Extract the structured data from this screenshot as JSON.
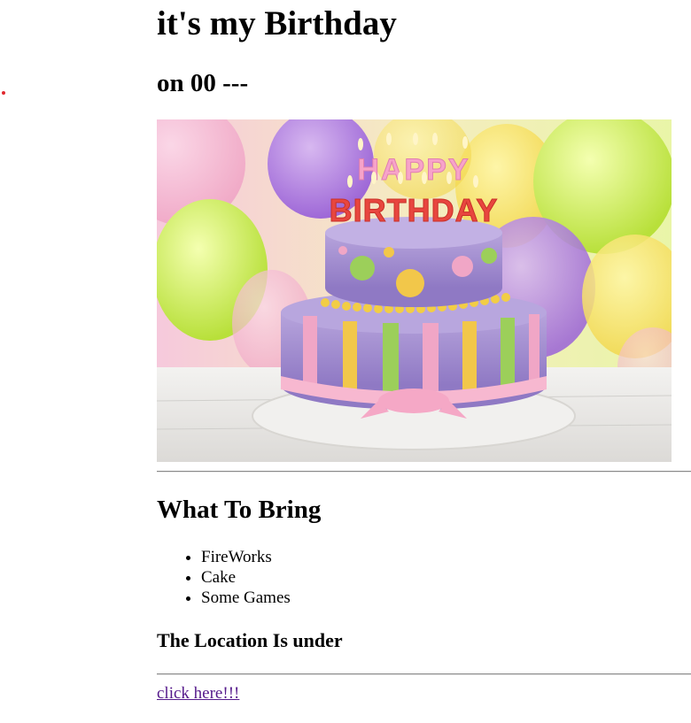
{
  "header": {
    "title": "it's my Birthday",
    "date": "on 00 ---"
  },
  "image": {
    "cake_top_text": "HAPPY",
    "cake_bottom_text": "BIRTHDAY"
  },
  "bring": {
    "heading": "What To Bring",
    "items": [
      "FireWorks",
      "Cake",
      "Some Games"
    ]
  },
  "location": {
    "heading": "The Location Is under"
  },
  "link": {
    "label": "click here!!!"
  },
  "colors": {
    "link_visited": "#551a8b",
    "dot": "#e0282f",
    "rule": "#8a8a8a"
  }
}
